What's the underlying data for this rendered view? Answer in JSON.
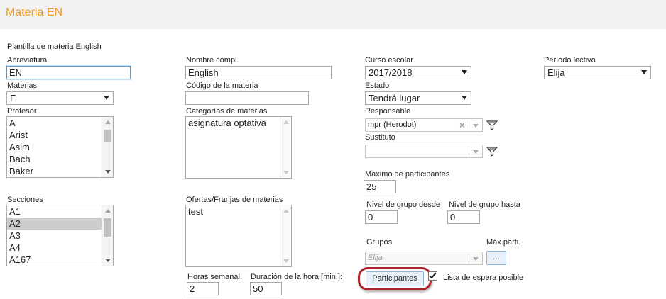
{
  "header": {
    "title": "Materia EN"
  },
  "template_label": "Plantilla de materia English",
  "abreviatura": {
    "label": "Abreviatura",
    "value": "EN"
  },
  "nombre": {
    "label": "Nombre compl.",
    "value": "English"
  },
  "curso": {
    "label": "Curso escolar",
    "value": "2017/2018"
  },
  "periodo": {
    "label": "Período lectivo",
    "value": "Elija"
  },
  "materias": {
    "label": "Materias",
    "value": "E"
  },
  "codigo": {
    "label": "Código de la materia",
    "value": ""
  },
  "estado": {
    "label": "Estado",
    "value": "Tendrá lugar"
  },
  "profesor": {
    "label": "Profesor",
    "items": [
      "A",
      "Arist",
      "Asim",
      "Bach",
      "Baker"
    ]
  },
  "categorias": {
    "label": "Categorías de materias",
    "items": [
      "asignatura optativa"
    ]
  },
  "responsable": {
    "label": "Responsable",
    "value": "mpr (Herodot)"
  },
  "sustituto": {
    "label": "Sustituto",
    "value": ""
  },
  "max_participantes": {
    "label": "Máximo de participantes",
    "value": "25"
  },
  "secciones": {
    "label": "Secciones",
    "items": [
      "A1",
      "A2",
      "A3",
      "A4",
      "A167"
    ],
    "selected": "A2"
  },
  "ofertas": {
    "label": "Ofertas/Franjas de materias",
    "items": [
      "test"
    ]
  },
  "nivel_desde": {
    "label": "Nivel de grupo desde",
    "value": "0"
  },
  "nivel_hasta": {
    "label": "Nivel de grupo hasta",
    "value": "0"
  },
  "grupos": {
    "label": "Grupos",
    "placeholder": "Elija"
  },
  "max_parti": {
    "label": "Máx.parti.",
    "button": "..."
  },
  "horas": {
    "label": "Horas semanal.",
    "value": "2"
  },
  "duracion": {
    "label": "Duración de la hora [min.]:",
    "value": "50"
  },
  "participantes_button": "Participantes",
  "lista_espera": {
    "label": "Lista de espera posible",
    "checked": true
  },
  "colors": {
    "accent": "#f39a1e",
    "highlight": "#a8232b"
  }
}
